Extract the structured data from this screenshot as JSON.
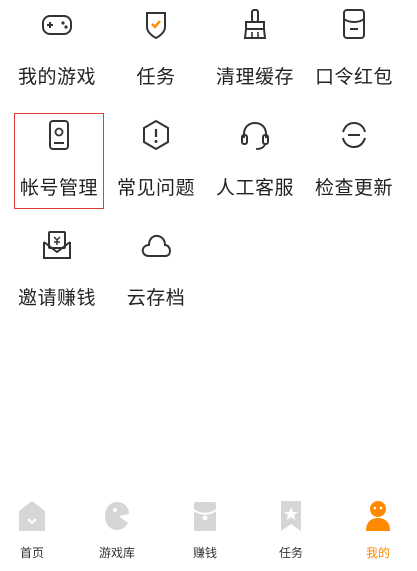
{
  "menu": [
    {
      "label": "我的游戏",
      "icon": "gamepad-icon"
    },
    {
      "label": "任务",
      "icon": "task-shield-icon"
    },
    {
      "label": "清理缓存",
      "icon": "brush-icon"
    },
    {
      "label": "口令红包",
      "icon": "red-packet-icon"
    },
    {
      "label": "帐号管理",
      "icon": "account-phone-icon",
      "highlighted": true
    },
    {
      "label": "常见问题",
      "icon": "faq-hexagon-icon"
    },
    {
      "label": "人工客服",
      "icon": "headset-icon"
    },
    {
      "label": "检查更新",
      "icon": "refresh-icon"
    },
    {
      "label": "邀请赚钱",
      "icon": "invite-envelope-icon"
    },
    {
      "label": "云存档",
      "icon": "cloud-icon"
    }
  ],
  "tabbar": [
    {
      "label": "首页",
      "icon": "home-icon",
      "active": false
    },
    {
      "label": "游戏库",
      "icon": "game-library-icon",
      "active": false
    },
    {
      "label": "赚钱",
      "icon": "earn-icon",
      "active": false
    },
    {
      "label": "任务",
      "icon": "task-bookmark-icon",
      "active": false
    },
    {
      "label": "我的",
      "icon": "profile-icon",
      "active": true
    }
  ],
  "colors": {
    "icon_stroke": "#333333",
    "accent": "#ff8a00",
    "highlight_border": "#e23c3c",
    "tab_icon_inactive": "#d0d0d0"
  }
}
